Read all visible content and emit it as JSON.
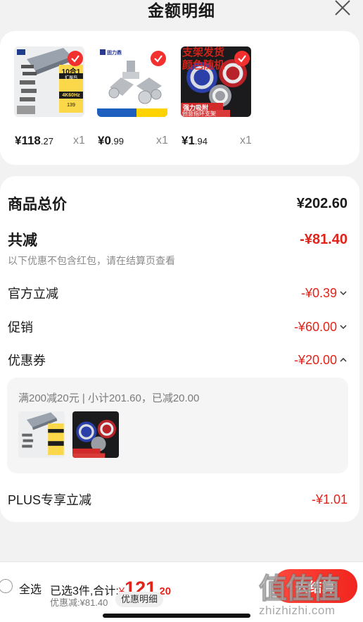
{
  "header": {
    "title": "金额明细",
    "close_icon": "close-icon"
  },
  "products": [
    {
      "price_int": "¥118",
      "price_dec": ".27",
      "qty": "x1",
      "thumb_text_1": "10合1",
      "thumb_text_2": "扩展坞",
      "thumb_text_3": "4K60Hz",
      "thumb_text_4": "139"
    },
    {
      "price_int": "¥0",
      "price_dec": ".99",
      "qty": "x1",
      "thumb_text_1": "固力鼎"
    },
    {
      "price_int": "¥1",
      "price_dec": ".94",
      "qty": "x1",
      "thumb_text_1": "支架发货",
      "thumb_text_2": "颜色随机",
      "thumb_text_3": "强力吸附",
      "thumb_text_4": "创意指环支架"
    }
  ],
  "detail": {
    "goods_total_label": "商品总价",
    "goods_total_value": "¥202.60",
    "total_discount_label": "共减",
    "total_discount_value": "-¥81.40",
    "note": "以下优惠不包含红包，请在结算页查看",
    "official_label": "官方立减",
    "official_value": "-¥0.39",
    "promo_label": "促销",
    "promo_value": "-¥60.00",
    "coupon_label": "优惠券",
    "coupon_value": "-¥20.00",
    "coupon_desc": "满200减20元 | 小计201.60，已减20.00",
    "plus_label": "PLUS专享立减",
    "plus_value": "-¥1.01"
  },
  "bottom": {
    "select_all": "全选",
    "summary_prefix": "已选3件,合计:",
    "total_symbol": "¥",
    "total_int": "121",
    "total_dec": ".20",
    "saved": "优惠减:¥81.40",
    "detail_pill": "优惠明细",
    "checkout": "去结算"
  },
  "watermark": {
    "logo": "值值值",
    "url": "zhizhizhi.com"
  },
  "colors": {
    "accent": "#e2231a",
    "checkout_start": "#ff4a3d",
    "checkout_end": "#f0251e"
  }
}
